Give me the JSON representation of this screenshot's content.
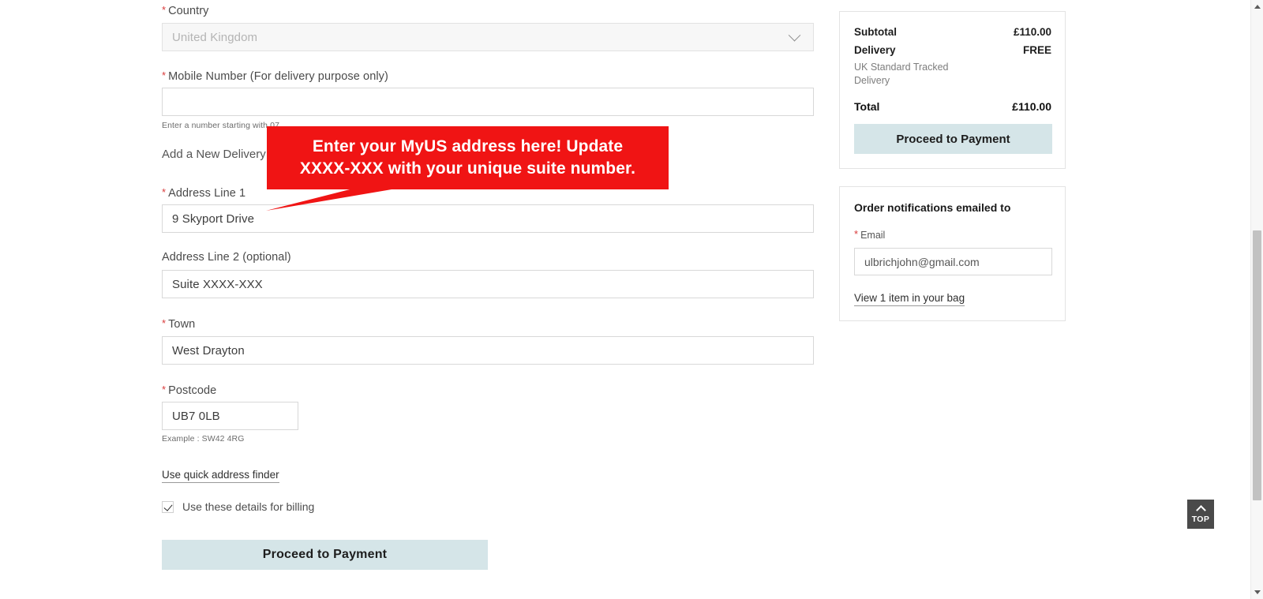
{
  "form": {
    "country": {
      "label": "Country",
      "required": true,
      "value": "United Kingdom",
      "icon": "chevron-down-icon",
      "disabled": true
    },
    "mobile": {
      "label": "Mobile Number (For delivery purpose only)",
      "required": true,
      "value": "",
      "placeholder": "",
      "hint": "Enter a number starting with 07"
    },
    "add_new_address": "Add a New Delivery Address",
    "address1": {
      "label": "Address Line 1",
      "required": true,
      "value": "9 Skyport Drive"
    },
    "address2": {
      "label": "Address Line 2 (optional)",
      "required": false,
      "value": "Suite XXXX-XXX"
    },
    "town": {
      "label": "Town",
      "required": true,
      "value": "West Drayton"
    },
    "postcode": {
      "label": "Postcode",
      "required": true,
      "value": "UB7 0LB",
      "hint": "Example : SW42 4RG"
    },
    "quick_finder_link": "Use quick address finder",
    "billing_checkbox": {
      "label": "Use these details for billing",
      "checked": true
    },
    "submit_button": "Proceed to Payment"
  },
  "callout": {
    "line1": "Enter your MyUS address here! Update",
    "line2": "XXXX-XXX with your unique suite number.",
    "background_color": "#f01414",
    "text_color": "#ffffff"
  },
  "summary": {
    "subtotal_label": "Subtotal",
    "subtotal_value": "£110.00",
    "delivery_label": "Delivery",
    "delivery_value": "FREE",
    "delivery_note": "UK Standard Tracked Delivery",
    "total_label": "Total",
    "total_value": "£110.00",
    "pay_button": "Proceed to Payment"
  },
  "notifications": {
    "title": "Order notifications emailed to",
    "email_label": "Email",
    "email_required": true,
    "email_value": "ulbrichjohn@gmail.com",
    "bag_link": "View 1 item in your bag"
  },
  "scroll_top": {
    "label": "TOP",
    "icon": "chevron-up-icon"
  },
  "colors": {
    "accent_button": "#d5e5e8",
    "required_star": "#d93a3a",
    "callout_red": "#f01414"
  }
}
